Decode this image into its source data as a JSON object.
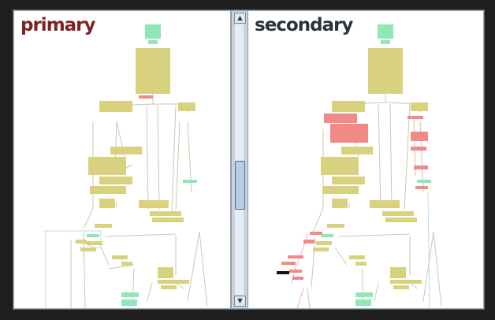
{
  "panes": {
    "primary": {
      "title": "primary",
      "title_color": "#7a2324"
    },
    "secondary": {
      "title": "secondary",
      "title_color": "#2a3340"
    }
  },
  "icons": {
    "scroll_up": "▲",
    "scroll_down": "▼"
  },
  "colors": {
    "node_default": "#d8d27e",
    "node_changed": "#ef8a86",
    "node_entry_exit": "#8fe6b6",
    "node_deleted": "#141414",
    "edge": "#c9c9b3",
    "edge_highlight": "#b8dde8"
  }
}
